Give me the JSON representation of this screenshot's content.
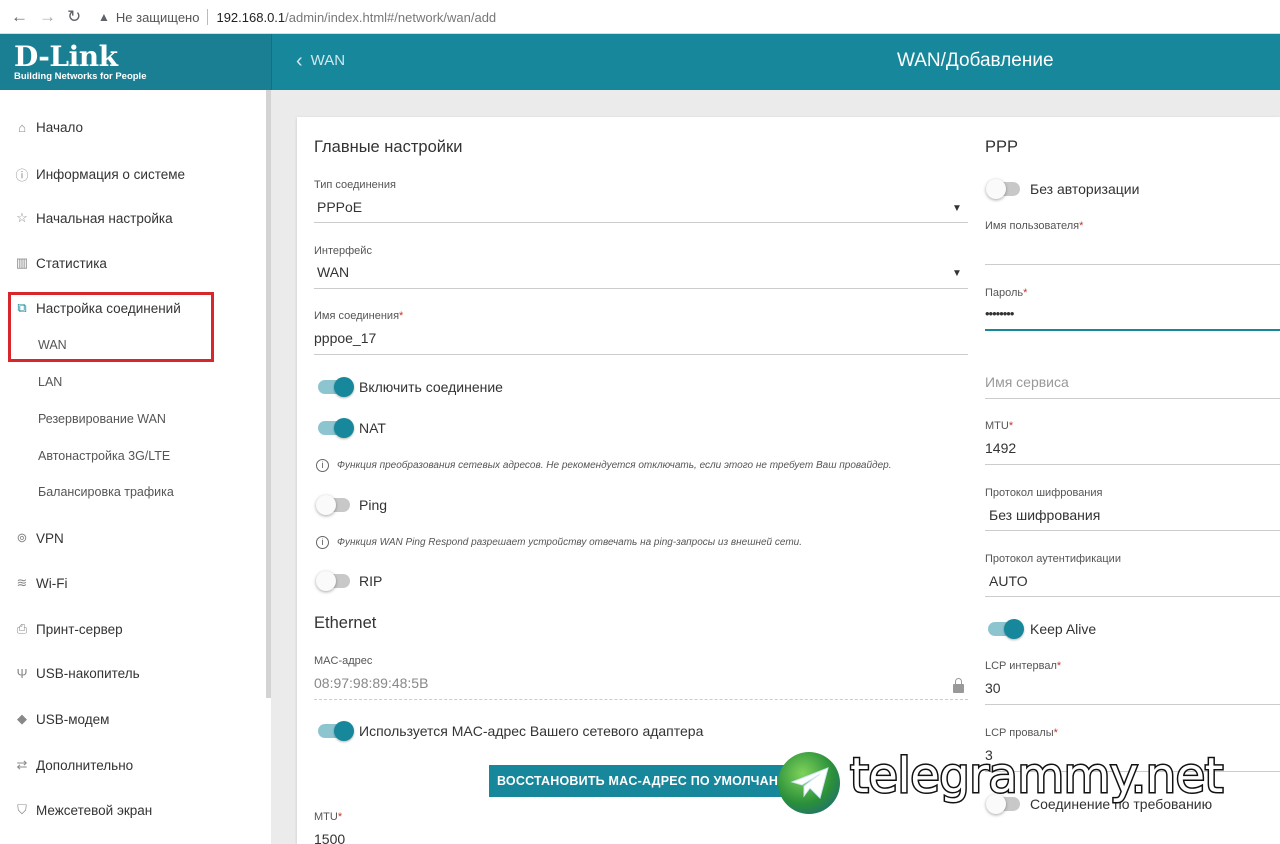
{
  "browser": {
    "back": "←",
    "forward": "→",
    "reload": "↻",
    "warning": "▲",
    "security": "Не защищено",
    "url_host": "192.168.0.1",
    "url_path": "/admin/index.html#/network/wan/add"
  },
  "header": {
    "brand": "D-Link",
    "tagline": "Building Networks for People",
    "back_label": "WAN",
    "title": "WAN/Добавление"
  },
  "sidebar": {
    "items": [
      {
        "label": "Начало",
        "icon": "home-icon"
      },
      {
        "label": "Информация о системе",
        "icon": "info-icon"
      },
      {
        "label": "Начальная настройка",
        "icon": "wizard-icon"
      },
      {
        "label": "Статистика",
        "icon": "stats-icon"
      },
      {
        "label": "Настройка соединений",
        "icon": "connections-icon"
      },
      {
        "label": "VPN",
        "icon": "vpn-icon"
      },
      {
        "label": "Wi-Fi",
        "icon": "wifi-icon"
      },
      {
        "label": "Принт-сервер",
        "icon": "printer-icon"
      },
      {
        "label": "USB-накопитель",
        "icon": "usb-icon"
      },
      {
        "label": "USB-модем",
        "icon": "modem-icon"
      },
      {
        "label": "Дополнительно",
        "icon": "advanced-icon"
      },
      {
        "label": "Межсетевой экран",
        "icon": "firewall-icon"
      }
    ],
    "subitems": [
      "WAN",
      "LAN",
      "Резервирование WAN",
      "Автонастройка 3G/LTE",
      "Балансировка трафика"
    ]
  },
  "main": {
    "title": "Главные настройки",
    "connection_type": {
      "label": "Тип соединения",
      "value": "PPPoE"
    },
    "interface": {
      "label": "Интерфейс",
      "value": "WAN"
    },
    "connection_name": {
      "label": "Имя соединения",
      "value": "pppoe_17"
    },
    "enable_label": "Включить соединение",
    "nat_label": "NAT",
    "nat_hint": "Функция преобразования сетевых адресов. Не рекомендуется отключать, если этого не требует Ваш провайдер.",
    "ping_label": "Ping",
    "ping_hint": "Функция WAN Ping Respond разрешает устройству отвечать на ping-запросы из внешней сети.",
    "rip_label": "RIP",
    "toggles": {
      "enable": true,
      "nat": true,
      "ping": false,
      "rip": false
    }
  },
  "ethernet": {
    "title": "Ethernet",
    "mac": {
      "label": "MAC-адрес",
      "value": "08:97:98:89:48:5B"
    },
    "use_adapter_mac_label": "Используется MAC-адрес Вашего сетевого адаптера",
    "use_adapter_mac": true,
    "restore_button": "ВОССТАНОВИТЬ MAC-АДРЕС ПО УМОЛЧАНИЮ",
    "mtu": {
      "label": "MTU",
      "value": "1500"
    }
  },
  "ppp": {
    "title": "PPP",
    "no_auth_label": "Без авторизации",
    "no_auth": false,
    "username": {
      "label": "Имя пользователя",
      "value": ""
    },
    "password": {
      "label": "Пароль",
      "value": "••••••••"
    },
    "service_placeholder": "Имя сервиса",
    "mtu": {
      "label": "MTU",
      "value": "1492"
    },
    "encryption": {
      "label": "Протокол шифрования",
      "value": "Без шифрования"
    },
    "auth_protocol": {
      "label": "Протокол аутентификации",
      "value": "AUTO"
    },
    "keep_alive_label": "Keep Alive",
    "keep_alive": true,
    "lcp_interval": {
      "label": "LCP интервал",
      "value": "30"
    },
    "lcp_failures": {
      "label": "LCP провалы",
      "value": "3"
    },
    "on_demand_label": "Соединение по требованию"
  },
  "required_mark": "*",
  "hint_icon": "i",
  "dropdown_arrow": "▼",
  "watermark": "telegrammy.net",
  "colors": {
    "accent": "#17879b",
    "highlight": "#d9262c"
  }
}
